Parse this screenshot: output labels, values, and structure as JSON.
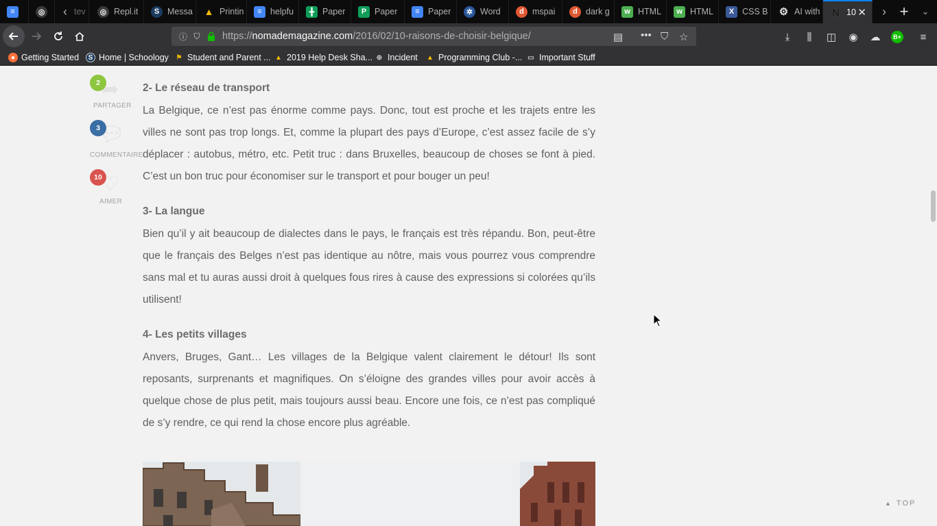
{
  "tabs": [
    {
      "title": "",
      "icon": "google-docs-icon",
      "color": "#4285f4"
    },
    {
      "title": "",
      "icon": "replit-icon",
      "color": "#8a8a8a"
    },
    {
      "title": "Repl.it",
      "icon": "replit-icon",
      "color": "#8a8a8a"
    },
    {
      "title": "Messa",
      "icon": "schoology-icon",
      "color": "#1b3c5e"
    },
    {
      "title": "Printin",
      "icon": "google-drive-icon",
      "color": "#fbbc04"
    },
    {
      "title": "helpfu",
      "icon": "google-docs-icon",
      "color": "#4285f4"
    },
    {
      "title": "Paper",
      "icon": "google-sheets-icon",
      "color": "#0f9d58"
    },
    {
      "title": "Paper",
      "icon": "google-slides-icon",
      "color": "#0f9d58"
    },
    {
      "title": "Paper",
      "icon": "google-docs-icon",
      "color": "#4285f4"
    },
    {
      "title": "Word",
      "icon": "word-icon",
      "color": "#2b579a"
    },
    {
      "title": "mspai",
      "icon": "duckduckgo-icon",
      "color": "#de5833"
    },
    {
      "title": "dark g",
      "icon": "duckduckgo-icon",
      "color": "#de5833"
    },
    {
      "title": "HTML",
      "icon": "w3-icon",
      "color": "#4caf50"
    },
    {
      "title": "HTML",
      "icon": "w3-icon",
      "color": "#4caf50"
    },
    {
      "title": "CSS B",
      "icon": "x-icon",
      "color": "#3b5998"
    },
    {
      "title": "AI with",
      "icon": "openai-icon",
      "color": "#666666"
    },
    {
      "title": "10",
      "icon": "nomade-icon",
      "color": "#111111"
    }
  ],
  "hidden_tab_label": "tev",
  "nav": {
    "url_prefix": "https://",
    "url_host": "nomademagazine.com",
    "url_path": "/2016/02/10-raisons-de-choisir-belgique/",
    "account_badge": "B+"
  },
  "bookmarks": [
    {
      "label": "Getting Started",
      "icon": "firefox-icon",
      "color": "#ff7139"
    },
    {
      "label": "Home | Schoology",
      "icon": "schoology-icon",
      "color": "#1b3c5e"
    },
    {
      "label": "Student and Parent ...",
      "icon": "bookmark-icon",
      "color": "#e4b400"
    },
    {
      "label": "2019 Help Desk Sha...",
      "icon": "google-drive-icon",
      "color": "#fbbc04"
    },
    {
      "label": "Incident",
      "icon": "globe-icon",
      "color": "#9a9a9a"
    },
    {
      "label": "Programming Club -...",
      "icon": "google-drive-icon",
      "color": "#fbbc04"
    },
    {
      "label": "Important Stuff",
      "icon": "folder-icon",
      "color": "#c8c8c8"
    }
  ],
  "share": {
    "partager": {
      "count": "2",
      "label": "PARTAGER",
      "color": "#8dc63f"
    },
    "commentaire": {
      "count": "3",
      "label": "COMMENTAIRE",
      "color": "#3a6ea5"
    },
    "aimer": {
      "count": "10",
      "label": "AIMER",
      "color": "#d9534f"
    }
  },
  "article": {
    "s2_title": "2- Le réseau de transport",
    "s2_text": "La Belgique, ce n’est pas énorme comme pays. Donc, tout est proche et les trajets entre les villes ne sont pas trop longs. Et, comme la plupart des pays d’Europe, c’est assez facile de s’y déplacer : autobus, métro, etc. Petit truc : dans Bruxelles, beaucoup de choses se font à pied. C’est un bon truc pour économiser sur le transport et pour bouger un peu!",
    "s3_title": "3- La langue",
    "s3_text": "Bien qu’il y ait beaucoup de dialectes dans le pays, le français est très répandu. Bon, peut-être que le français des Belges n’est pas identique au nôtre, mais vous pourrez vous comprendre sans mal et tu auras aussi droit à quelques fous rires à cause des expressions si colorées qu’ils utilisent!",
    "s4_title": "4- Les petits villages",
    "s4_text": "Anvers, Bruges, Gant… Les villages de la Belgique valent clairement le détour! Ils sont reposants, surprenants et magnifiques. On s’éloigne des grandes villes pour avoir accès à quelque chose de plus petit, mais toujours aussi beau. Encore une fois, ce n’est pas compliqué de s’y rendre, ce qui rend la chose encore plus agréable."
  },
  "top_label": "TOP"
}
